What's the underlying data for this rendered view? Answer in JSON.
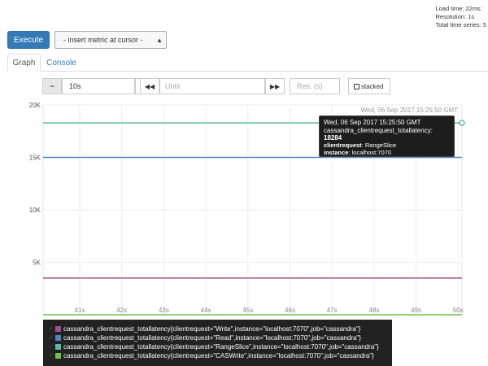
{
  "stats": {
    "load_time": "Load time: 22ms",
    "resolution": "Resolution: 1s",
    "total_series": "Total time series: 5"
  },
  "toolbar": {
    "execute_label": "Execute",
    "metric_select": "- insert metric at cursor -"
  },
  "tabs": [
    {
      "label": "Graph",
      "active": true
    },
    {
      "label": "Console",
      "active": false
    }
  ],
  "controls": {
    "minus_label": "−",
    "range_value": "10s",
    "plus_label": "+",
    "back_label": "◀◀",
    "until_placeholder": "Until",
    "forward_label": "▶▶",
    "resolution_placeholder": "Res. (s)",
    "stacked_label": "stacked"
  },
  "hover_time_label": "Wed, 06 Sep 2017 15:25:50 GMT",
  "tooltip": {
    "time": "Wed, 06 Sep 2017 15:25:50 GMT",
    "metric": "cassandra_clientrequest_totallatency:",
    "value": "18284",
    "labels": [
      {
        "key": "clientrequest",
        "value": "RangeSlice"
      },
      {
        "key": "instance",
        "value": "localhost:7070"
      },
      {
        "key": "job",
        "value": "cassandra"
      }
    ]
  },
  "colors": {
    "write": "#a0508c",
    "read": "#4d87c1",
    "rangeslice": "#5cb8a4",
    "caswrite": "#73c045"
  },
  "legend": [
    {
      "label": "cassandra_clientrequest_totallatency{clientrequest=\"Write\",instance=\"localhost:7070\",job=\"cassandra\"}",
      "color": "#a0508c"
    },
    {
      "label": "cassandra_clientrequest_totallatency{clientrequest=\"Read\",instance=\"localhost:7070\",job=\"cassandra\"}",
      "color": "#4d87c1"
    },
    {
      "label": "cassandra_clientrequest_totallatency{clientrequest=\"RangeSlice\",instance=\"localhost:7070\",job=\"cassandra\"}",
      "color": "#5cb8a4"
    },
    {
      "label": "cassandra_clientrequest_totallatency{clientrequest=\"CASWrite\",instance=\"localhost:7070\",job=\"cassandra\"}",
      "color": "#73c045"
    }
  ],
  "chart_data": {
    "type": "line",
    "x": [
      "41s",
      "42s",
      "43s",
      "44s",
      "45s",
      "46s",
      "47s",
      "48s",
      "49s",
      "50s"
    ],
    "y_ticks": [
      "20K",
      "15K",
      "10K",
      "5K"
    ],
    "ylim": [
      0,
      20000
    ],
    "series": [
      {
        "name": "Write",
        "values": [
          3500,
          3500,
          3500,
          3500,
          3500,
          3500,
          3500,
          3500,
          3500,
          3500
        ]
      },
      {
        "name": "Read",
        "values": [
          15000,
          15000,
          15000,
          15000,
          15000,
          15000,
          15000,
          15000,
          15000,
          15000
        ]
      },
      {
        "name": "RangeSlice",
        "values": [
          18284,
          18284,
          18284,
          18284,
          18284,
          18284,
          18284,
          18284,
          18284,
          18284
        ]
      },
      {
        "name": "CASWrite",
        "values": [
          0,
          0,
          0,
          0,
          0,
          0,
          0,
          0,
          0,
          0
        ]
      }
    ]
  }
}
